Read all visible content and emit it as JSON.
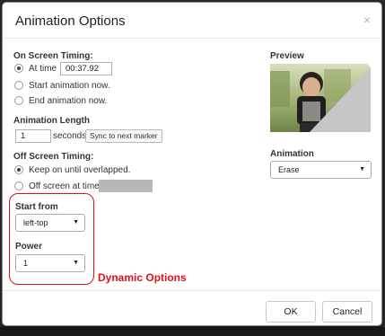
{
  "dialog": {
    "title": "Animation Options",
    "close_glyph": "×"
  },
  "on_screen": {
    "heading": "On Screen Timing:",
    "option_at_time": "At time",
    "time_value": "00:37.92",
    "option_start": "Start animation now.",
    "option_end": "End animation now.",
    "selected": "at_time"
  },
  "length": {
    "heading": "Animation Length",
    "value": "1",
    "unit": "seconds",
    "sync_button": "Sync to next marker"
  },
  "off_screen": {
    "heading": "Off Screen Timing:",
    "option_keep": "Keep on until overlapped.",
    "option_off": "Off screen at time",
    "selected": "keep"
  },
  "dynamic": {
    "start_from_label": "Start from",
    "start_from_value": "left-top",
    "power_label": "Power",
    "power_value": "1",
    "annotation": "Dynamic Options"
  },
  "preview": {
    "label": "Preview"
  },
  "animation": {
    "label": "Animation",
    "value": "Erase"
  },
  "footer": {
    "ok": "OK",
    "cancel": "Cancel"
  },
  "colors": {
    "highlight": "#e0101a",
    "erase_overlay": "#c6c6c6"
  },
  "icons": {
    "close": "close-icon",
    "caret": "chevron-down-icon"
  }
}
